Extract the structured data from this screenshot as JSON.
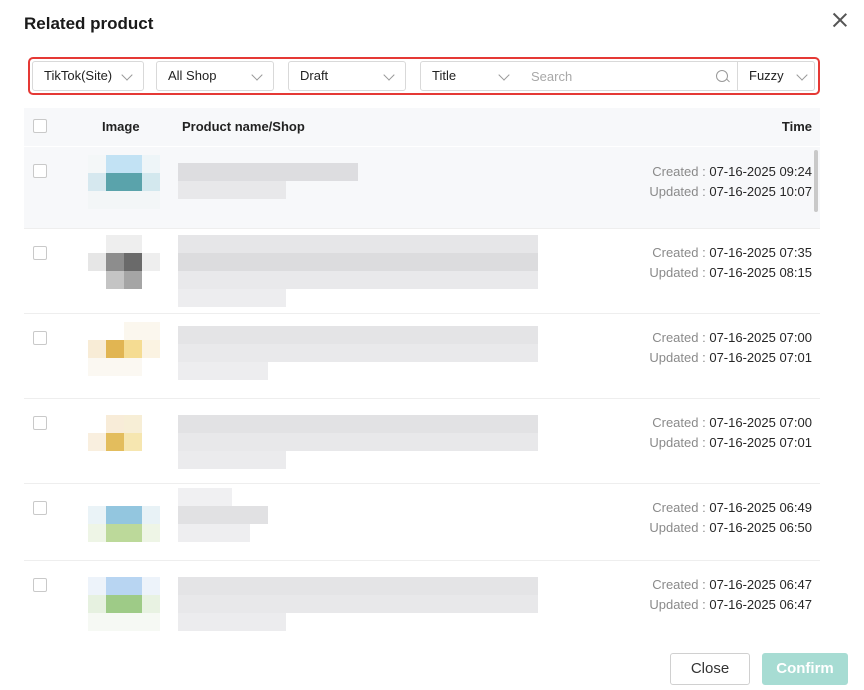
{
  "dialog": {
    "title": "Related product"
  },
  "filters": {
    "platform": "TikTok(Site)",
    "shop": "All Shop",
    "status": "Draft",
    "field": "Title",
    "search_placeholder": "Search",
    "search_value": "",
    "match_mode": "Fuzzy"
  },
  "table": {
    "columns": {
      "image": "Image",
      "product": "Product name/Shop",
      "time": "Time"
    },
    "created_label": "Created :",
    "updated_label": "Updated :",
    "rows": [
      {
        "created": "07-16-2025 09:24",
        "updated": "07-16-2025 10:07"
      },
      {
        "created": "07-16-2025 07:35",
        "updated": "07-16-2025 08:15"
      },
      {
        "created": "07-16-2025 07:00",
        "updated": "07-16-2025 07:01"
      },
      {
        "created": "07-16-2025 07:00",
        "updated": "07-16-2025 07:01"
      },
      {
        "created": "07-16-2025 06:49",
        "updated": "07-16-2025 06:50"
      },
      {
        "created": "07-16-2025 06:47",
        "updated": "07-16-2025 06:47"
      }
    ]
  },
  "footer": {
    "close_label": "Close",
    "confirm_label": "Confirm"
  },
  "colors": {
    "highlight_border": "#e53935",
    "confirm_bg": "#a7dcd3",
    "header_bg": "#f7f8fa"
  }
}
